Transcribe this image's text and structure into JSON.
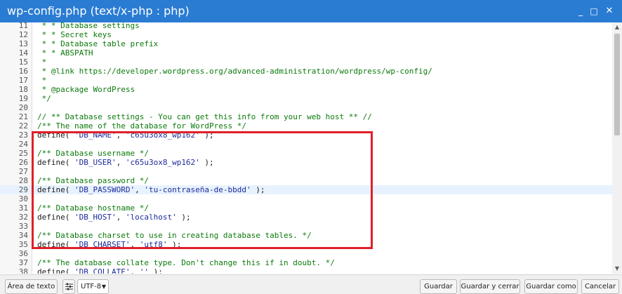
{
  "window": {
    "title": "wp-config.php (text/x-php : php)",
    "minimize_glyph": "_",
    "maximize_glyph": "□",
    "close_glyph": "✕"
  },
  "editor": {
    "lines": [
      {
        "num": "11",
        "parts": [
          {
            "t": " * * Database settings",
            "c": "com"
          }
        ]
      },
      {
        "num": "12",
        "parts": [
          {
            "t": " * * Secret keys",
            "c": "com"
          }
        ]
      },
      {
        "num": "13",
        "parts": [
          {
            "t": " * * Database table prefix",
            "c": "com"
          }
        ]
      },
      {
        "num": "14",
        "parts": [
          {
            "t": " * * ABSPATH",
            "c": "com"
          }
        ]
      },
      {
        "num": "15",
        "parts": [
          {
            "t": " *",
            "c": "com"
          }
        ]
      },
      {
        "num": "16",
        "parts": [
          {
            "t": " * @link https://developer.wordpress.org/advanced-administration/wordpress/wp-config/",
            "c": "com"
          }
        ]
      },
      {
        "num": "17",
        "parts": [
          {
            "t": " *",
            "c": "com"
          }
        ]
      },
      {
        "num": "18",
        "parts": [
          {
            "t": " * @package WordPress",
            "c": "com"
          }
        ]
      },
      {
        "num": "19",
        "parts": [
          {
            "t": " */",
            "c": "com"
          }
        ]
      },
      {
        "num": "20",
        "parts": []
      },
      {
        "num": "21",
        "parts": [
          {
            "t": "// ** Database settings - You can get this info from your web host ** //",
            "c": "com"
          }
        ]
      },
      {
        "num": "22",
        "parts": [
          {
            "t": "/** The name of the database for WordPress */",
            "c": "com"
          }
        ]
      },
      {
        "num": "23",
        "parts": [
          {
            "t": "define( ",
            "c": "kw"
          },
          {
            "t": "'DB_NAME'",
            "c": "str"
          },
          {
            "t": ", ",
            "c": "kw"
          },
          {
            "t": "'c65u3ox8_wp162'",
            "c": "str"
          },
          {
            "t": " );",
            "c": "kw"
          }
        ]
      },
      {
        "num": "24",
        "parts": []
      },
      {
        "num": "25",
        "parts": [
          {
            "t": "/** Database username */",
            "c": "com"
          }
        ]
      },
      {
        "num": "26",
        "parts": [
          {
            "t": "define( ",
            "c": "kw"
          },
          {
            "t": "'DB_USER'",
            "c": "str"
          },
          {
            "t": ", ",
            "c": "kw"
          },
          {
            "t": "'c65u3ox8_wp162'",
            "c": "str"
          },
          {
            "t": " );",
            "c": "kw"
          }
        ]
      },
      {
        "num": "27",
        "parts": []
      },
      {
        "num": "28",
        "parts": [
          {
            "t": "/** Database password */",
            "c": "com"
          }
        ]
      },
      {
        "num": "29",
        "active": true,
        "parts": [
          {
            "t": "define( ",
            "c": "kw"
          },
          {
            "t": "'DB_PASSWORD'",
            "c": "str"
          },
          {
            "t": ", ",
            "c": "kw"
          },
          {
            "t": "'tu-contraseña-de-bbdd'",
            "c": "str"
          },
          {
            "t": " );",
            "c": "kw"
          }
        ]
      },
      {
        "num": "30",
        "parts": []
      },
      {
        "num": "31",
        "parts": [
          {
            "t": "/** Database hostname */",
            "c": "com"
          }
        ]
      },
      {
        "num": "32",
        "parts": [
          {
            "t": "define( ",
            "c": "kw"
          },
          {
            "t": "'DB_HOST'",
            "c": "str"
          },
          {
            "t": ", ",
            "c": "kw"
          },
          {
            "t": "'localhost'",
            "c": "str"
          },
          {
            "t": " );",
            "c": "kw"
          }
        ]
      },
      {
        "num": "33",
        "parts": []
      },
      {
        "num": "34",
        "parts": [
          {
            "t": "/** Database charset to use in creating database tables. */",
            "c": "com"
          }
        ]
      },
      {
        "num": "35",
        "parts": [
          {
            "t": "define( ",
            "c": "kw"
          },
          {
            "t": "'DB_CHARSET'",
            "c": "str"
          },
          {
            "t": ", ",
            "c": "kw"
          },
          {
            "t": "'utf8'",
            "c": "str"
          },
          {
            "t": " );",
            "c": "kw"
          }
        ]
      },
      {
        "num": "36",
        "parts": []
      },
      {
        "num": "37",
        "parts": [
          {
            "t": "/** The database collate type. Don't change this if in doubt. */",
            "c": "com"
          }
        ]
      },
      {
        "num": "38",
        "parts": [
          {
            "t": "define( ",
            "c": "kw"
          },
          {
            "t": "'DB_COLLATE'",
            "c": "str"
          },
          {
            "t": ", ",
            "c": "kw"
          },
          {
            "t": "''",
            "c": "str"
          },
          {
            "t": " );",
            "c": "kw"
          }
        ]
      }
    ]
  },
  "colors": {
    "titlebar": "#2a7cd3",
    "highlight_box": "#e0202a",
    "comment": "#0b7a0b",
    "string": "#1d2b9a"
  },
  "footer": {
    "textarea_label": "Área de texto",
    "settings_icon": "sliders-icon",
    "encoding_value": "UTF-8",
    "save_label": "Guardar",
    "save_close_label": "Guardar y cerrar",
    "save_as_label": "Guardar como",
    "cancel_label": "Cancelar"
  }
}
